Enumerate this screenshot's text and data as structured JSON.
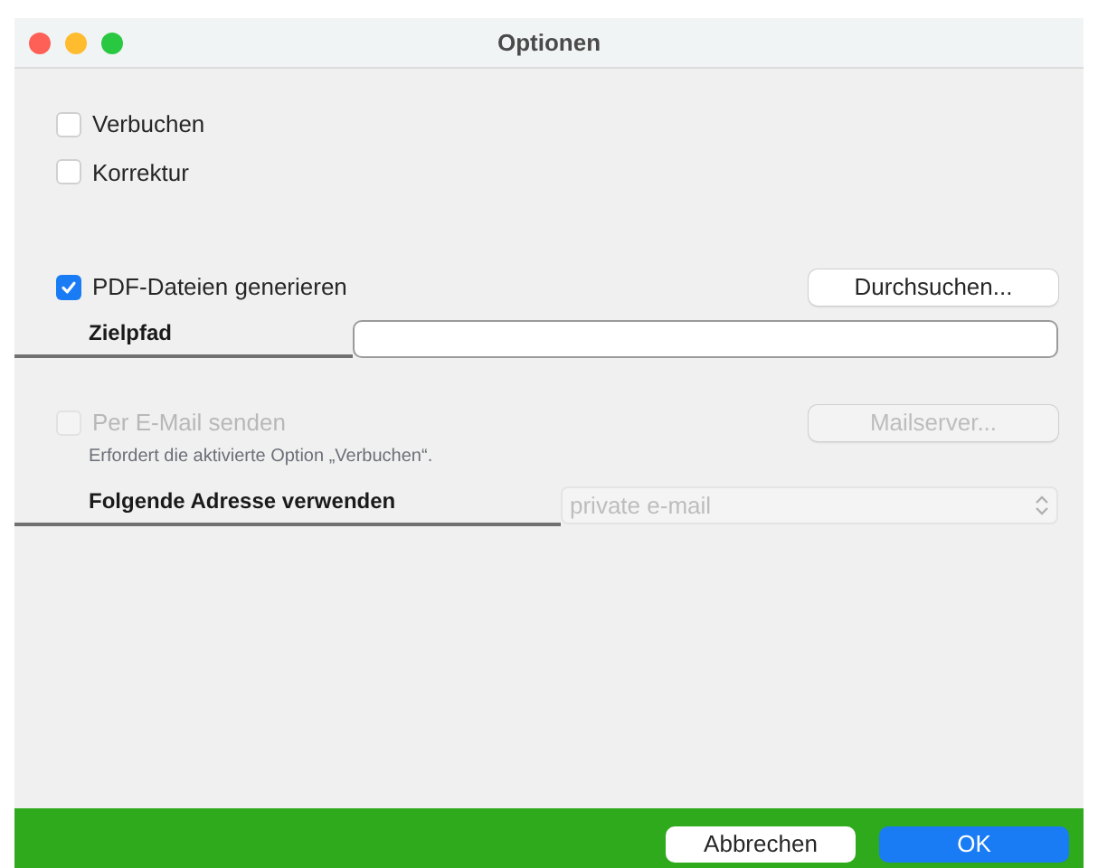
{
  "window": {
    "title": "Optionen"
  },
  "options": [
    {
      "label": "Verbuchen",
      "checked": false,
      "disabled": false
    },
    {
      "label": "Korrektur",
      "checked": false,
      "disabled": false
    }
  ],
  "pdf": {
    "checkbox": {
      "label": "PDF-Dateien generieren",
      "checked": true,
      "disabled": false
    },
    "browse_button": {
      "label": "Durchsuchen...",
      "disabled": false
    },
    "path_label": "Zielpfad"
  },
  "email": {
    "checkbox": {
      "label": "Per E-Mail senden",
      "checked": false,
      "disabled": true
    },
    "hint": "Erfordert die aktivierte Option „Verbuchen“.",
    "server_button": {
      "label": "Mailserver...",
      "disabled": true
    },
    "address_label": "Folgende Adresse verwenden",
    "address_select": {
      "value": "private e-mail",
      "disabled": true
    }
  },
  "buttons": [
    {
      "label": "Abbrechen",
      "kind": "cancel"
    },
    {
      "label": "OK",
      "kind": "default"
    }
  ]
}
